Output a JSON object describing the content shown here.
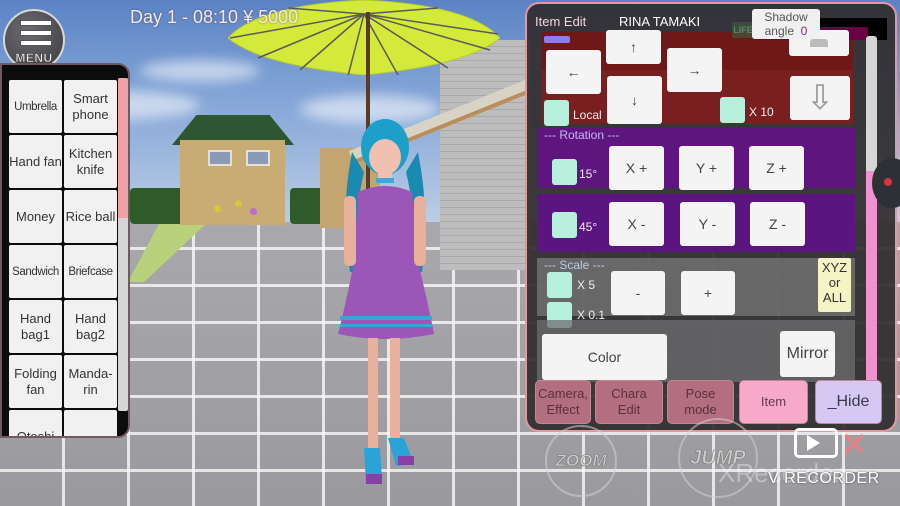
{
  "hud": {
    "status": "Day 1 - 08:10 ¥ 5000",
    "menu_label": "MENU"
  },
  "item_list": {
    "items": [
      {
        "label": "Umbrella",
        "tight": true
      },
      {
        "label": "Smart phone"
      },
      {
        "label": "Hand fan"
      },
      {
        "label": "Kitchen knife"
      },
      {
        "label": "Money"
      },
      {
        "label": "Rice ball"
      },
      {
        "label": "Sandwich",
        "tight": true
      },
      {
        "label": "Briefcase",
        "tight": true
      },
      {
        "label": "Hand bag1"
      },
      {
        "label": "Hand bag2"
      },
      {
        "label": "Folding fan"
      },
      {
        "label": "Manda- rin"
      },
      {
        "label": "Otoshi"
      },
      {
        "label": ""
      }
    ],
    "scroll_position": 0.0,
    "scroll_visible_fraction": 0.42
  },
  "item_edit": {
    "title": "Item Edit",
    "character_name": "RINA TAMAKI",
    "life_label": "LIFE",
    "life_fraction": 0.85,
    "shadow_label_1": "Shadow",
    "shadow_label_2": "angle",
    "shadow_value": "0",
    "move": {
      "up": "↑",
      "left": "←",
      "right": "→",
      "down": "↓",
      "lower": "⇩",
      "local_label": "Local",
      "x10_label": "X 10"
    },
    "rotation": {
      "title": "--- Rotation ---",
      "step1_label": "15°",
      "step2_label": "45°",
      "buttons_plus": [
        "X +",
        "Y +",
        "Z +"
      ],
      "buttons_minus": [
        "X -",
        "Y -",
        "Z -"
      ]
    },
    "scale": {
      "title": "--- Scale ---",
      "x5_label": "X 5",
      "x01_label": "X 0.1",
      "minus": "-",
      "plus": "+",
      "xyz_line1": "XYZ",
      "xyz_line2": "or",
      "xyz_line3": "ALL"
    },
    "color_label": "Color",
    "mirror_label": "Mirror",
    "scroll_position": 0.62,
    "scroll_visible_fraction": 0.61
  },
  "tabs": [
    {
      "line1": "Camera,",
      "line2": "Effect"
    },
    {
      "line1": "Chara",
      "line2": "Edit"
    },
    {
      "line1": "Pose",
      "line2": "mode"
    },
    {
      "line1": "Item",
      "line2": "",
      "active": true
    },
    {
      "line1": "_Hide",
      "line2": ""
    }
  ],
  "controls": {
    "zoom_label": "ZOOM",
    "jump_label": "JUMP"
  },
  "watermark": {
    "recorder_label": "V RECORDER",
    "xrecorder_label": "XRecorder"
  }
}
